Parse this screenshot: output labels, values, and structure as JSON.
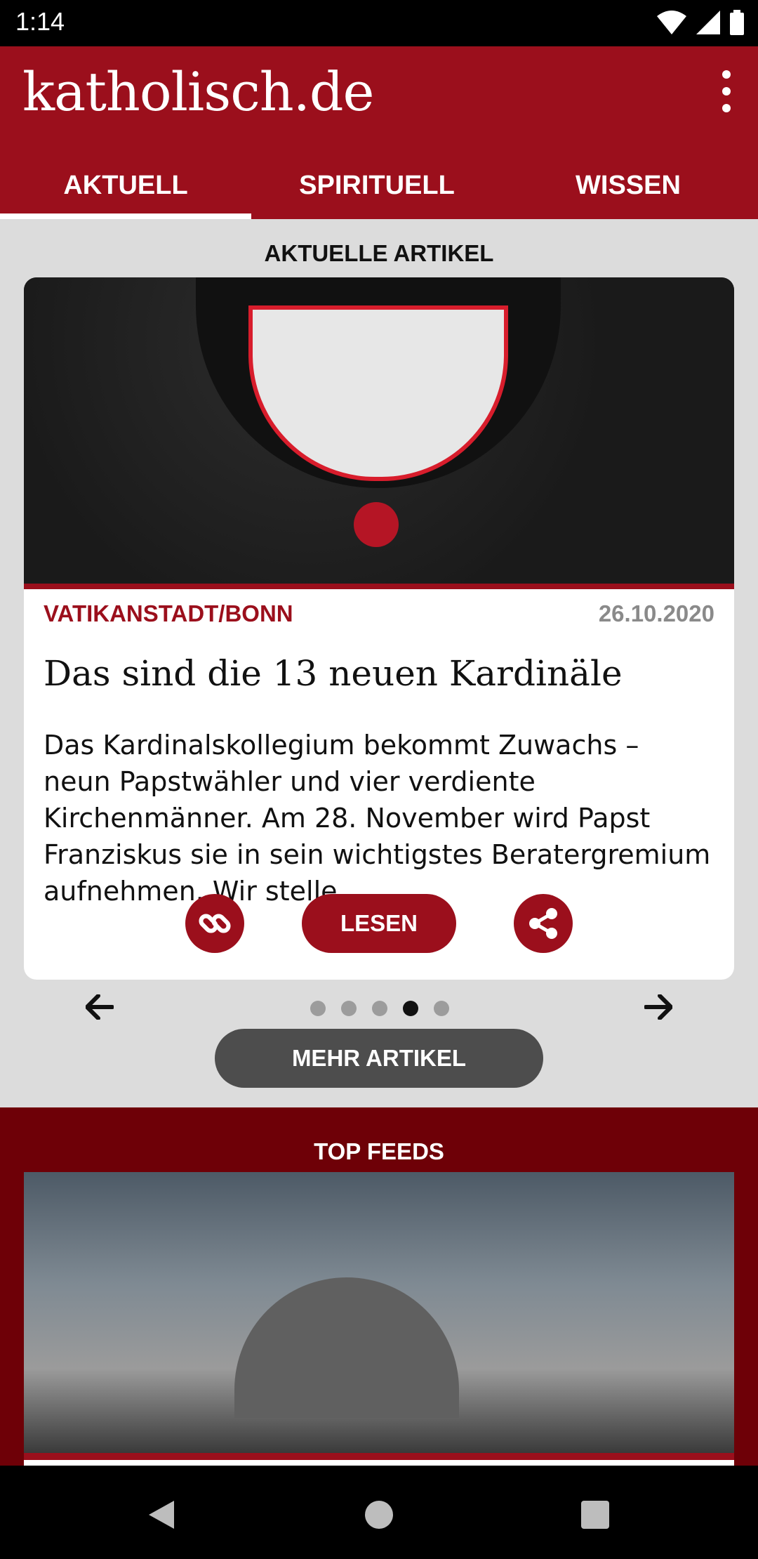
{
  "status_bar": {
    "time": "1:14",
    "icons": [
      "wifi-icon",
      "signal-icon",
      "battery-icon"
    ]
  },
  "app_bar": {
    "logo": "katholisch.de",
    "menu_icon": "more-vert-icon",
    "background": "#9b0f1c"
  },
  "tabs": [
    {
      "label": "AKTUELL",
      "active": true
    },
    {
      "label": "SPIRITUELL",
      "active": false
    },
    {
      "label": "WISSEN",
      "active": false
    }
  ],
  "current_articles": {
    "title": "AKTUELLE ARTIKEL",
    "article": {
      "place": "VATIKANSTADT/BONN",
      "date": "26.10.2020",
      "headline": "Das sind die 13 neuen Kardinäle",
      "teaser": "Das Kardinalskollegium bekommt Zuwachs – neun Papstwähler und vier verdiente Kirchenmänner. Am 28. November wird Papst Franziskus sie in sein wichtigstes Beratergremium aufnehmen. Wir stelle...",
      "read_label": "LESEN",
      "link_icon": "link-icon",
      "share_icon": "share-icon"
    },
    "pager": {
      "prev_icon": "arrow-left-icon",
      "next_icon": "arrow-right-icon",
      "dot_count": 5,
      "active_dot": 4
    },
    "more_label": "MEHR ARTIKEL"
  },
  "top_feeds": {
    "title": "TOP FEEDS"
  },
  "nav_bar": {
    "icons": [
      "back-icon",
      "home-icon",
      "recents-icon"
    ]
  }
}
